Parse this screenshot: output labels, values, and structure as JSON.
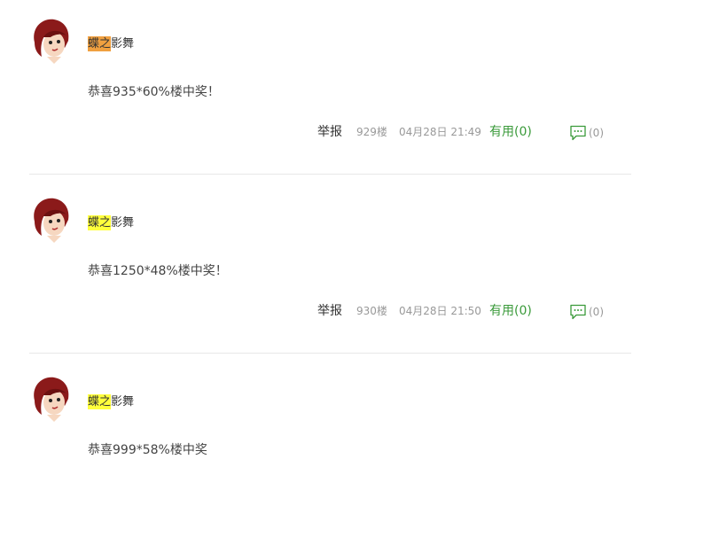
{
  "colors": {
    "highlight_orange": "#f0a040",
    "highlight_yellow": "#ffff3c",
    "useful_green": "#3a9a3a",
    "meta_gray": "#999999"
  },
  "posts": [
    {
      "username": {
        "highlight": "蝶之",
        "rest": "影舞",
        "highlight_color": "#f0a040"
      },
      "content": "恭喜935*60%楼中奖！",
      "report": "举报",
      "floor": "929楼",
      "time": "04月28日 21:49",
      "useful": "有用(0)",
      "comments": "(0)"
    },
    {
      "username": {
        "highlight": "蝶之",
        "rest": "影舞",
        "highlight_color": "#ffff3c"
      },
      "content": "恭喜1250*48%楼中奖！",
      "report": "举报",
      "floor": "930楼",
      "time": "04月28日 21:50",
      "useful": "有用(0)",
      "comments": "(0)"
    },
    {
      "username": {
        "highlight": "蝶之",
        "rest": "影舞",
        "highlight_color": "#ffff3c"
      },
      "content": "恭喜999*58%楼中奖"
    }
  ]
}
